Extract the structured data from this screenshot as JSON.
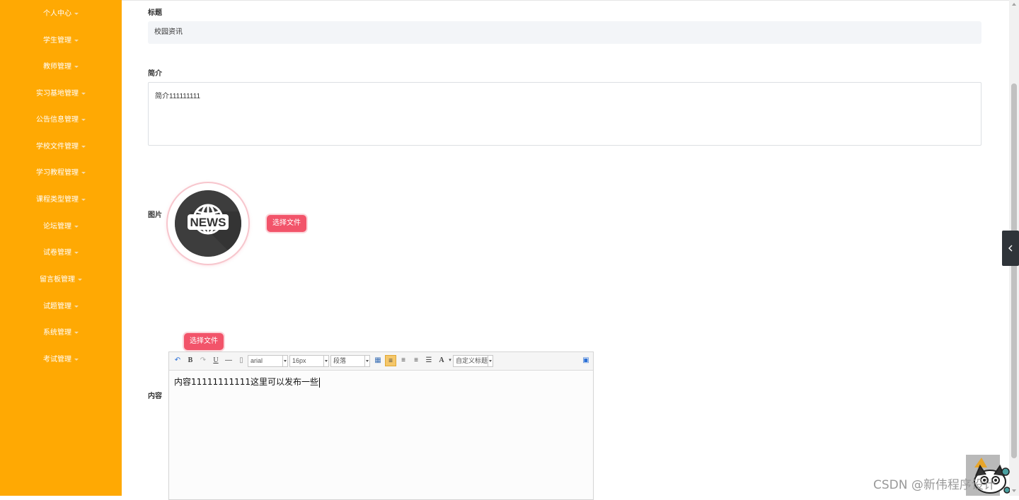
{
  "sidebar": {
    "items": [
      {
        "label": "个人中心"
      },
      {
        "label": "学生管理"
      },
      {
        "label": "教师管理"
      },
      {
        "label": "实习基地管理"
      },
      {
        "label": "公告信息管理"
      },
      {
        "label": "学校文件管理"
      },
      {
        "label": "学习教程管理"
      },
      {
        "label": "课程类型管理"
      },
      {
        "label": "论坛管理"
      },
      {
        "label": "试卷管理"
      },
      {
        "label": "留言板管理"
      },
      {
        "label": "试题管理"
      },
      {
        "label": "系统管理"
      },
      {
        "label": "考试管理"
      }
    ]
  },
  "form": {
    "title_label": "标题",
    "title_value": "校园资讯",
    "intro_label": "简介",
    "intro_value": "简介111111111",
    "image_label": "图片",
    "image_text": "NEWS",
    "pick_file_button": "选择文件",
    "content_label": "内容",
    "content_pick_button": "选择文件"
  },
  "editor": {
    "font_family": "arial",
    "font_size": "16px",
    "paragraph": "段落",
    "custom_title": "自定义标题",
    "content_text": "内容11111111111这里可以发布一些"
  },
  "watermark": "CSDN @新伟程序设计",
  "colors": {
    "sidebar_bg": "#FFA903",
    "button_bg": "#f2546a",
    "input_bg": "#f3f5f8"
  }
}
